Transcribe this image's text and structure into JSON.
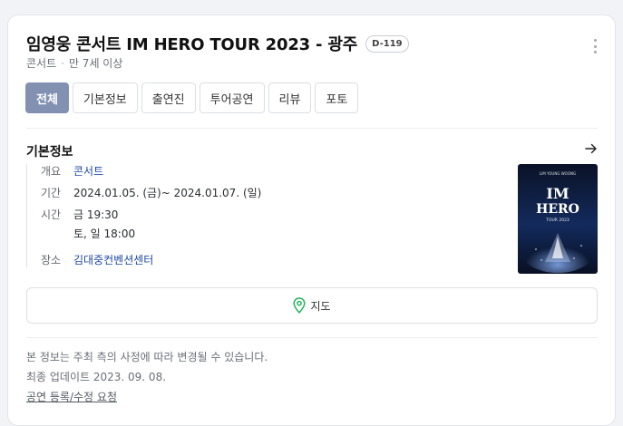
{
  "header": {
    "title": "임영웅 콘서트 IM HERO TOUR 2023 - 광주",
    "dday": "D-119",
    "category": "콘서트",
    "age": "만 7세 이상"
  },
  "tabs": [
    {
      "label": "전체",
      "active": true
    },
    {
      "label": "기본정보",
      "active": false
    },
    {
      "label": "출연진",
      "active": false
    },
    {
      "label": "투어공연",
      "active": false
    },
    {
      "label": "리뷰",
      "active": false
    },
    {
      "label": "포토",
      "active": false
    }
  ],
  "basic_info": {
    "section_title": "기본정보",
    "overview_label": "개요",
    "overview_value": "콘서트",
    "period_label": "기간",
    "period_value": "2024.01.05. (금)~ 2024.01.07. (일)",
    "time_label": "시간",
    "time_line1": "금 19:30",
    "time_line2": "토, 일 18:00",
    "venue_label": "장소",
    "venue_value": "김대중컨벤션센터"
  },
  "poster": {
    "top_text": "LIM YOUNG WOONG",
    "title_line1": "IM",
    "title_line2": "HERO",
    "subtitle": "TOUR 2023"
  },
  "map_button": {
    "label": "지도",
    "icon": "map-pin-icon",
    "color": "#22b35c"
  },
  "footer": {
    "notice": "본 정보는 주최 측의 사정에 따라 변경될 수 있습니다.",
    "updated": "최종 업데이트 2023. 09. 08.",
    "report_link": "공연 등록/수정 요청"
  },
  "colors": {
    "active_tab": "#8291b2",
    "link": "#1f4aa6",
    "background": "#f1f3f6"
  }
}
